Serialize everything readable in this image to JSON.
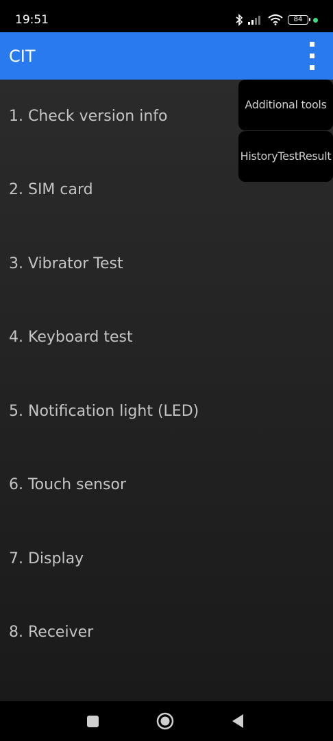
{
  "status_bar": {
    "time": "19:51",
    "battery_level": "84",
    "icons": [
      "bluetooth-icon",
      "signal-icon",
      "wifi-icon",
      "battery-icon",
      "privacy-dot-icon"
    ],
    "privacy_dot_color": "#3ddc84"
  },
  "app_bar": {
    "title": "CIT",
    "background_color": "#2979ef",
    "overflow_icon": "more-vertical-icon"
  },
  "overflow_menu": {
    "items": [
      {
        "label": "Additional tools"
      },
      {
        "label": "HistoryTestResult"
      }
    ]
  },
  "test_list": {
    "items": [
      {
        "label": "1. Check version info"
      },
      {
        "label": "2. SIM card"
      },
      {
        "label": "3. Vibrator Test"
      },
      {
        "label": "4. Keyboard test"
      },
      {
        "label": "5. Notification light (LED)"
      },
      {
        "label": "6. Touch sensor"
      },
      {
        "label": "7. Display"
      },
      {
        "label": "8. Receiver"
      }
    ]
  },
  "nav_bar": {
    "buttons": [
      "recents-square-icon",
      "home-circle-icon",
      "back-triangle-icon"
    ]
  }
}
